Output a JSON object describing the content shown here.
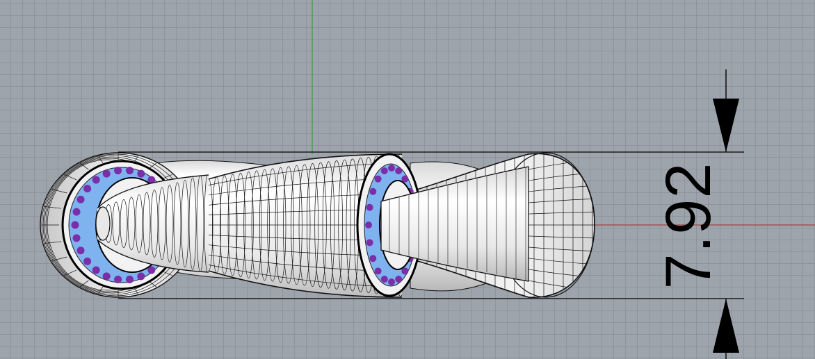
{
  "viewport": {
    "background": "#9ea4ac",
    "grid_color": "#82888f",
    "x_axis_color": "#a04040",
    "y_axis_color": "#3a9a3a"
  },
  "model": {
    "surface_color": "#ececec",
    "wire_color": "#111111",
    "bearing_ring_color": "#7fb3f0",
    "bearing_ball_color": "#7a2ea8"
  },
  "dimension": {
    "value": "7.92",
    "line_color": "#000000"
  }
}
